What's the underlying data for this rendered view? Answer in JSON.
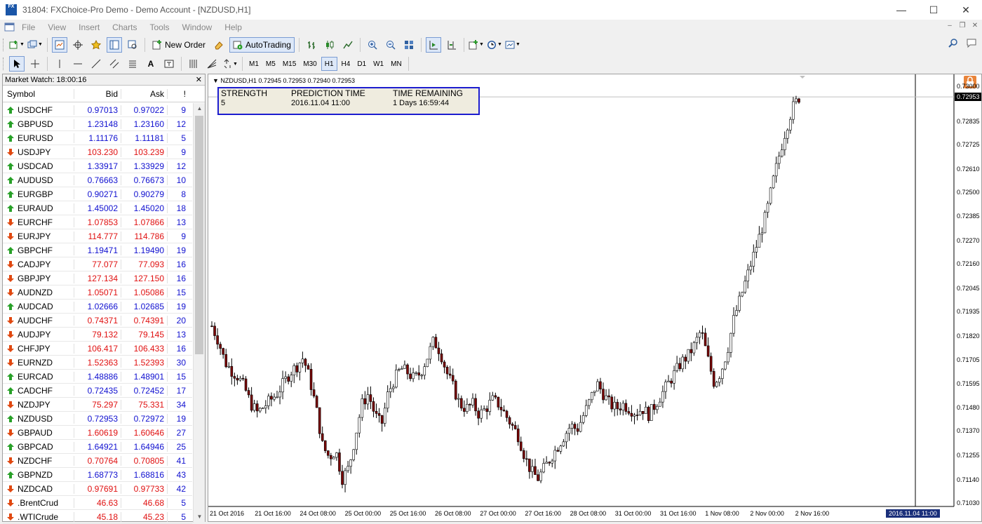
{
  "window": {
    "title": "31804: FXChoice-Pro Demo - Demo Account - [NZDUSD,H1]",
    "app_icon_text": "FX"
  },
  "menu": [
    "File",
    "View",
    "Insert",
    "Charts",
    "Tools",
    "Window",
    "Help"
  ],
  "toolbar": {
    "new_order": "New Order",
    "autotrading": "AutoTrading"
  },
  "timeframes": [
    "M1",
    "M5",
    "M15",
    "M30",
    "H1",
    "H4",
    "D1",
    "W1",
    "MN"
  ],
  "active_timeframe": "H1",
  "market_watch": {
    "title": "Market Watch: 18:00:16",
    "columns": {
      "symbol": "Symbol",
      "bid": "Bid",
      "ask": "Ask",
      "spread": "!"
    },
    "rows": [
      {
        "symbol": "USDCHF",
        "bid": "0.97013",
        "ask": "0.97022",
        "spread": "9",
        "dir": "up"
      },
      {
        "symbol": "GBPUSD",
        "bid": "1.23148",
        "ask": "1.23160",
        "spread": "12",
        "dir": "up"
      },
      {
        "symbol": "EURUSD",
        "bid": "1.11176",
        "ask": "1.11181",
        "spread": "5",
        "dir": "up"
      },
      {
        "symbol": "USDJPY",
        "bid": "103.230",
        "ask": "103.239",
        "spread": "9",
        "dir": "down"
      },
      {
        "symbol": "USDCAD",
        "bid": "1.33917",
        "ask": "1.33929",
        "spread": "12",
        "dir": "up"
      },
      {
        "symbol": "AUDUSD",
        "bid": "0.76663",
        "ask": "0.76673",
        "spread": "10",
        "dir": "up"
      },
      {
        "symbol": "EURGBP",
        "bid": "0.90271",
        "ask": "0.90279",
        "spread": "8",
        "dir": "up"
      },
      {
        "symbol": "EURAUD",
        "bid": "1.45002",
        "ask": "1.45020",
        "spread": "18",
        "dir": "up"
      },
      {
        "symbol": "EURCHF",
        "bid": "1.07853",
        "ask": "1.07866",
        "spread": "13",
        "dir": "down"
      },
      {
        "symbol": "EURJPY",
        "bid": "114.777",
        "ask": "114.786",
        "spread": "9",
        "dir": "down"
      },
      {
        "symbol": "GBPCHF",
        "bid": "1.19471",
        "ask": "1.19490",
        "spread": "19",
        "dir": "up"
      },
      {
        "symbol": "CADJPY",
        "bid": "77.077",
        "ask": "77.093",
        "spread": "16",
        "dir": "down"
      },
      {
        "symbol": "GBPJPY",
        "bid": "127.134",
        "ask": "127.150",
        "spread": "16",
        "dir": "down"
      },
      {
        "symbol": "AUDNZD",
        "bid": "1.05071",
        "ask": "1.05086",
        "spread": "15",
        "dir": "down"
      },
      {
        "symbol": "AUDCAD",
        "bid": "1.02666",
        "ask": "1.02685",
        "spread": "19",
        "dir": "up"
      },
      {
        "symbol": "AUDCHF",
        "bid": "0.74371",
        "ask": "0.74391",
        "spread": "20",
        "dir": "down"
      },
      {
        "symbol": "AUDJPY",
        "bid": "79.132",
        "ask": "79.145",
        "spread": "13",
        "dir": "down"
      },
      {
        "symbol": "CHFJPY",
        "bid": "106.417",
        "ask": "106.433",
        "spread": "16",
        "dir": "down"
      },
      {
        "symbol": "EURNZD",
        "bid": "1.52363",
        "ask": "1.52393",
        "spread": "30",
        "dir": "down"
      },
      {
        "symbol": "EURCAD",
        "bid": "1.48886",
        "ask": "1.48901",
        "spread": "15",
        "dir": "up"
      },
      {
        "symbol": "CADCHF",
        "bid": "0.72435",
        "ask": "0.72452",
        "spread": "17",
        "dir": "up"
      },
      {
        "symbol": "NZDJPY",
        "bid": "75.297",
        "ask": "75.331",
        "spread": "34",
        "dir": "down"
      },
      {
        "symbol": "NZDUSD",
        "bid": "0.72953",
        "ask": "0.72972",
        "spread": "19",
        "dir": "up"
      },
      {
        "symbol": "GBPAUD",
        "bid": "1.60619",
        "ask": "1.60646",
        "spread": "27",
        "dir": "down"
      },
      {
        "symbol": "GBPCAD",
        "bid": "1.64921",
        "ask": "1.64946",
        "spread": "25",
        "dir": "up"
      },
      {
        "symbol": "NZDCHF",
        "bid": "0.70764",
        "ask": "0.70805",
        "spread": "41",
        "dir": "down"
      },
      {
        "symbol": "GBPNZD",
        "bid": "1.68773",
        "ask": "1.68816",
        "spread": "43",
        "dir": "up"
      },
      {
        "symbol": "NZDCAD",
        "bid": "0.97691",
        "ask": "0.97733",
        "spread": "42",
        "dir": "down"
      },
      {
        "symbol": ".BrentCrud",
        "bid": "46.63",
        "ask": "46.68",
        "spread": "5",
        "dir": "down"
      },
      {
        "symbol": ".WTICrude",
        "bid": "45.18",
        "ask": "45.23",
        "spread": "5",
        "dir": "down"
      }
    ]
  },
  "chart": {
    "label": "NZDUSD,H1  0.72945 0.72953 0.72940 0.72953",
    "prediction": {
      "h_strength": "STRENGTH",
      "h_time": "PREDICTION TIME",
      "h_remaining": "TIME REMAINING",
      "strength": "5",
      "time": "2016.11.04 11:00",
      "remaining": "1 Days 16:59:44"
    },
    "current_price": "0.72953",
    "time_marker": "2016.11.04 11:00"
  },
  "colors": {
    "up": "#1010d0",
    "down": "#e01010",
    "bull_candle": "#ffffff",
    "bear_candle": "#7a0000",
    "wick": "#000000",
    "box_border": "#1d1dcf"
  },
  "chart_data": {
    "type": "candlestick",
    "title": "NZDUSD,H1",
    "price_ticks": [
      "0.73000",
      "0.72953",
      "0.72835",
      "0.72725",
      "0.72610",
      "0.72500",
      "0.72385",
      "0.72270",
      "0.72160",
      "0.72045",
      "0.71935",
      "0.71820",
      "0.71705",
      "0.71595",
      "0.71480",
      "0.71370",
      "0.71255",
      "0.71140",
      "0.71030"
    ],
    "ylim": [
      0.7103,
      0.73
    ],
    "time_ticks": [
      "21 Oct 2016",
      "21 Oct 16:00",
      "24 Oct 08:00",
      "25 Oct 00:00",
      "25 Oct 16:00",
      "26 Oct 08:00",
      "27 Oct 00:00",
      "27 Oct 16:00",
      "28 Oct 08:00",
      "31 Oct 00:00",
      "31 Oct 16:00",
      "1 Nov 08:00",
      "2 Nov 00:00",
      "2 Nov 16:00"
    ],
    "close_path": [
      0.7187,
      0.718,
      0.717,
      0.7166,
      0.7163,
      0.7158,
      0.715,
      0.7146,
      0.7149,
      0.7152,
      0.7155,
      0.716,
      0.7165,
      0.7168,
      0.7172,
      0.7162,
      0.7148,
      0.713,
      0.7125,
      0.7128,
      0.7115,
      0.712,
      0.7135,
      0.715,
      0.7155,
      0.7145,
      0.714,
      0.7155,
      0.7162,
      0.7167,
      0.7165,
      0.7162,
      0.7165,
      0.7172,
      0.718,
      0.7175,
      0.7165,
      0.7158,
      0.715,
      0.7148,
      0.715,
      0.7145,
      0.7148,
      0.7152,
      0.715,
      0.7145,
      0.714,
      0.7135,
      0.7125,
      0.7118,
      0.7115,
      0.712,
      0.7125,
      0.713,
      0.7135,
      0.714,
      0.7138,
      0.7145,
      0.7152,
      0.716,
      0.7155,
      0.715,
      0.7148,
      0.715,
      0.7148,
      0.7146,
      0.7148,
      0.7145,
      0.715,
      0.7155,
      0.716,
      0.7165,
      0.717,
      0.7173,
      0.7178,
      0.7185,
      0.7172,
      0.716,
      0.7165,
      0.7175,
      0.719,
      0.72,
      0.721,
      0.722,
      0.723,
      0.724,
      0.7255,
      0.7268,
      0.728,
      0.729,
      0.7295
    ]
  }
}
